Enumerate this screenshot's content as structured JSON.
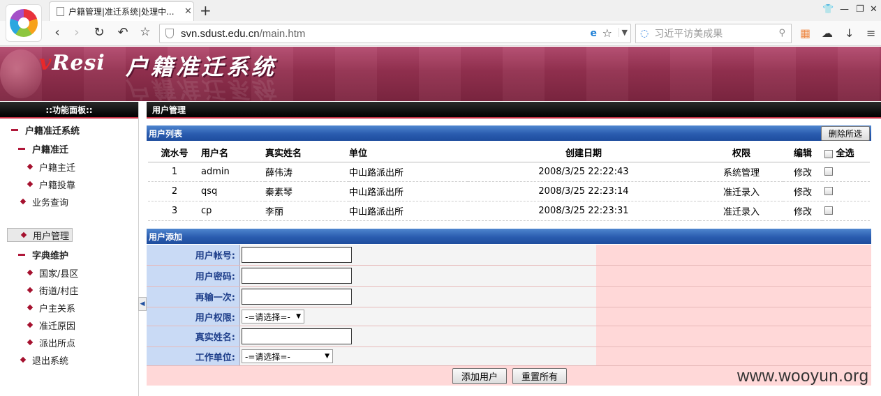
{
  "browser": {
    "tab_title": "户籍管理|准迁系统|处理中...",
    "tab_close": "✕",
    "new_tab": "+",
    "url_host": "svn.sdust.edu.cn",
    "url_path": "/main.htm",
    "search_placeholder": "习近平访美成果",
    "icons": [
      "back-icon",
      "forward-icon",
      "reload-icon",
      "undo-icon",
      "bookmark-star-icon"
    ]
  },
  "banner": {
    "brand_v": "v",
    "brand_rest": "Resi",
    "title": "户籍准迁系统"
  },
  "sidebar": {
    "header": "::功能面板::",
    "items": [
      {
        "label": "户籍准迁系统"
      },
      {
        "label": "户籍准迁"
      },
      {
        "label": "户籍主迁"
      },
      {
        "label": "户籍投靠"
      },
      {
        "label": "业务查询"
      },
      {
        "label": "用户管理"
      },
      {
        "label": "字典维护"
      },
      {
        "label": "国家/县区"
      },
      {
        "label": "街道/村庄"
      },
      {
        "label": "户主关系"
      },
      {
        "label": "准迁原因"
      },
      {
        "label": "派出所点"
      },
      {
        "label": "退出系统"
      }
    ]
  },
  "main": {
    "header": "用户管理",
    "list_section": "用户列表",
    "delete_selected": "删除所选",
    "columns": {
      "no": "流水号",
      "username": "用户名",
      "realname": "真实姓名",
      "unit": "单位",
      "created": "创建日期",
      "permission": "权限",
      "edit": "编辑",
      "select_all": "全选"
    },
    "rows": [
      {
        "no": "1",
        "username": "admin",
        "realname": "薛伟涛",
        "unit": "中山路派出所",
        "created": "2008/3/25 22:22:43",
        "permission": "系统管理",
        "edit": "修改"
      },
      {
        "no": "2",
        "username": "qsq",
        "realname": "秦素琴",
        "unit": "中山路派出所",
        "created": "2008/3/25 22:23:14",
        "permission": "准迁录入",
        "edit": "修改"
      },
      {
        "no": "3",
        "username": "cp",
        "realname": "李丽",
        "unit": "中山路派出所",
        "created": "2008/3/25 22:23:31",
        "permission": "准迁录入",
        "edit": "修改"
      }
    ],
    "add_section": "用户添加",
    "form": {
      "account_label": "用户帐号:",
      "password_label": "用户密码:",
      "repeat_label": "再输一次:",
      "permission_label": "用户权限:",
      "permission_selected": "-=请选择=-",
      "realname_label": "真实姓名:",
      "unit_label": "工作单位:",
      "unit_selected": "-=请选择=-",
      "add_button": "添加用户",
      "reset_button": "重置所有"
    }
  },
  "watermark": "www.wooyun.org",
  "colors": {
    "banner": "#93304f",
    "section_bar": "#2a5caf",
    "label_bg": "#c9daf5",
    "form_pink": "#ffd8d8"
  }
}
